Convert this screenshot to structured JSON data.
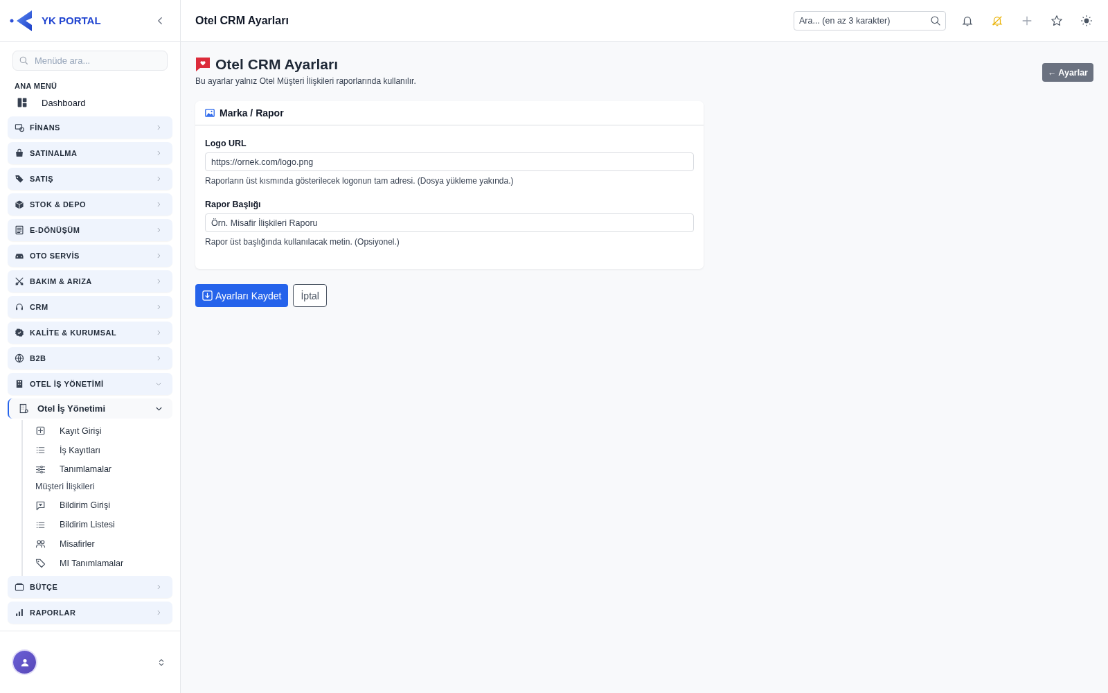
{
  "brand": {
    "name": "YK PORTAL"
  },
  "sidebar": {
    "search": {
      "placeholder": "Menüde ara..."
    },
    "section_label": "ANA MENÜ",
    "items": [
      {
        "label": "Dashboard"
      }
    ],
    "groups": [
      {
        "label": "FİNANS",
        "expanded": false
      },
      {
        "label": "SATINALMA",
        "expanded": false
      },
      {
        "label": "SATIŞ",
        "expanded": false
      },
      {
        "label": "STOK & DEPO",
        "expanded": false
      },
      {
        "label": "E-DÖNÜŞÜM",
        "expanded": false
      },
      {
        "label": "OTO SERVİS",
        "expanded": false
      },
      {
        "label": "BAKIM & ARIZA",
        "expanded": false
      },
      {
        "label": "CRM",
        "expanded": false
      },
      {
        "label": "KALİTE & KURUMSAL",
        "expanded": false
      },
      {
        "label": "B2B",
        "expanded": false
      },
      {
        "label": "OTEL İŞ YÖNETİMİ",
        "expanded": true,
        "children": [
          {
            "label": "Otel İş Yönetimi",
            "expanded": true,
            "selected": true,
            "children": [
              {
                "kind": "link",
                "label": "Kayıt Girişi"
              },
              {
                "kind": "link",
                "label": "İş Kayıtları"
              },
              {
                "kind": "link",
                "label": "Tanımlamalar"
              },
              {
                "kind": "heading",
                "label": "Müşteri İlişkileri"
              },
              {
                "kind": "link",
                "label": "Bildirim Girişi"
              },
              {
                "kind": "link",
                "label": "Bildirim Listesi"
              },
              {
                "kind": "link",
                "label": "Misafirler"
              },
              {
                "kind": "link",
                "label": "MI Tanımlamalar"
              }
            ]
          }
        ]
      },
      {
        "label": "BÜTÇE",
        "expanded": false
      },
      {
        "label": "RAPORLAR",
        "expanded": false
      }
    ]
  },
  "header": {
    "title": "Otel CRM Ayarları",
    "search": {
      "placeholder": "Ara... (en az 3 karakter)"
    }
  },
  "page": {
    "title": "Otel CRM Ayarları",
    "subtitle": "Bu ayarlar yalnız Otel Müşteri İlişkileri raporlarında kullanılır.",
    "back_button": "← Ayarlar",
    "card": {
      "title": "Marka / Rapor",
      "fields": [
        {
          "label": "Logo URL",
          "placeholder": "https://ornek.com/logo.png",
          "help": "Raporların üst kısmında gösterilecek logonun tam adresi. (Dosya yükleme yakında.)"
        },
        {
          "label": "Rapor Başlığı",
          "placeholder": "Örn. Misafir İlişkileri Raporu",
          "help": "Rapor üst başlığında kullanılacak metin. (Opsiyonel.)"
        }
      ]
    },
    "buttons": [
      {
        "label": "Ayarları Kaydet",
        "kind": "primary"
      },
      {
        "label": "İptal",
        "kind": "secondary"
      }
    ]
  }
}
